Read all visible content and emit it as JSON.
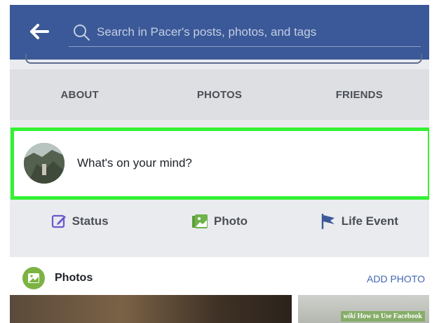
{
  "colors": {
    "header": "#3b5998",
    "highlight": "#33f233",
    "link": "#4267b2",
    "photos_icon": "#7cb342"
  },
  "header": {
    "back_icon": "left-arrow-icon",
    "search_icon": "magnifier-icon",
    "search_placeholder": "Search in Pacer's posts, photos, and tags"
  },
  "tabs": [
    {
      "label": "ABOUT"
    },
    {
      "label": "PHOTOS"
    },
    {
      "label": "FRIENDS"
    }
  ],
  "composer": {
    "prompt": "What's on your mind?"
  },
  "actions": [
    {
      "label": "Status",
      "icon": "edit-icon"
    },
    {
      "label": "Photo",
      "icon": "photo-icon"
    },
    {
      "label": "Life Event",
      "icon": "flag-icon"
    }
  ],
  "photos": {
    "title": "Photos",
    "add_label": "ADD PHOTO"
  },
  "watermark": {
    "prefix": "wiki",
    "text": "How to Use Facebook"
  }
}
